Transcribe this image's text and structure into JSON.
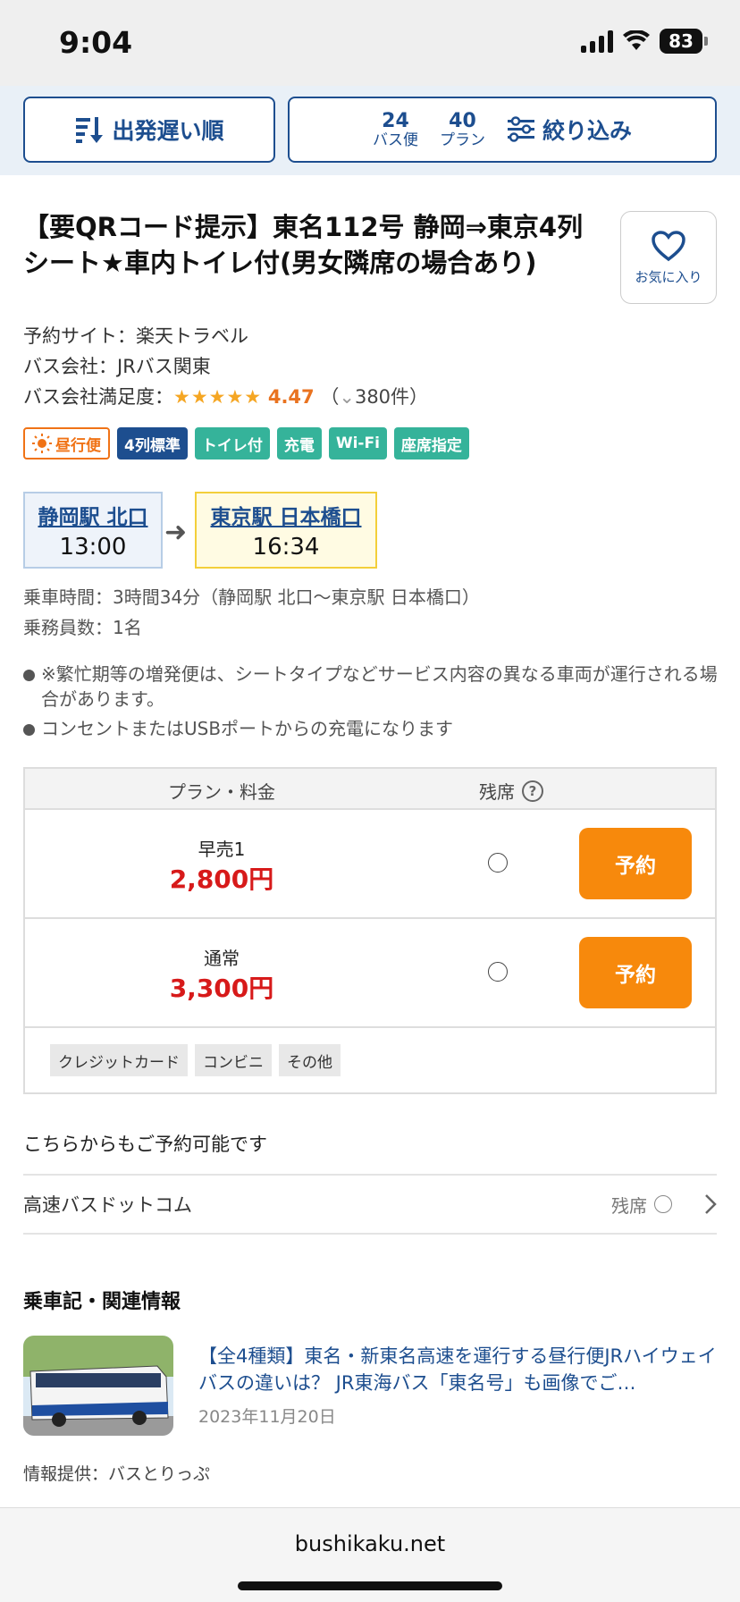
{
  "status": {
    "time": "9:04",
    "battery": "83"
  },
  "toolbar": {
    "sort_label": "出発遅い順",
    "bus_count": "24",
    "bus_count_label": "バス便",
    "plan_count": "40",
    "plan_count_label": "プラン",
    "filter_label": "絞り込み"
  },
  "title": "【要QRコード提示】東名112号 静岡⇒東京4列シート★車内トイレ付(男女隣席の場合あり)",
  "favorite_label": "お気に入り",
  "info": {
    "site": "予約サイト：楽天トラベル",
    "company": "バス会社：JRバス関東",
    "rating_label": "バス会社満足度：",
    "stars": "★★★★★",
    "rating": "4.47",
    "reviews_open": "（",
    "reviews_count": "380件",
    "reviews_close": "）"
  },
  "badges": [
    "昼行便",
    "4列標準",
    "トイレ付",
    "充電",
    "Wi-Fi",
    "座席指定"
  ],
  "route": {
    "departure_stop": "静岡駅 北口",
    "departure_time": "13:00",
    "arrival_stop": "東京駅 日本橋口",
    "arrival_time": "16:34"
  },
  "ride_time": "乗車時間：3時間34分（静岡駅 北口〜東京駅 日本橋口）",
  "crew": "乗務員数：1名",
  "notes": [
    "※繁忙期等の増発便は、シートタイプなどサービス内容の異なる車両が運行される場合があります。",
    "コンセントまたはUSBポートからの充電になります"
  ],
  "plans": {
    "header_plan": "プラン・料金",
    "header_seats": "残席",
    "rows": [
      {
        "name": "早売1",
        "price": "2,800円",
        "button": "予約"
      },
      {
        "name": "通常",
        "price": "3,300円",
        "button": "予約"
      }
    ],
    "payments": [
      "クレジットカード",
      "コンビニ",
      "その他"
    ]
  },
  "also_available": "こちらからもご予約可能です",
  "other_site": {
    "name": "高速バスドットコム",
    "seats_label": "残席"
  },
  "related": {
    "section_title": "乗車記・関連情報",
    "article_title": "【全4種類】東名・新東名高速を運行する昼行便JRハイウェイバスの違いは？ JR東海バス「東名号」も画像でご…",
    "article_date": "2023年11月20日",
    "source": "情報提供：バスとりっぷ"
  },
  "footer": {
    "domain": "bushikaku.net"
  },
  "colors": {
    "brand_blue": "#1d4e8f",
    "reserve_orange": "#f7890c",
    "price_red": "#d71a1a",
    "star": "#f5a623"
  }
}
